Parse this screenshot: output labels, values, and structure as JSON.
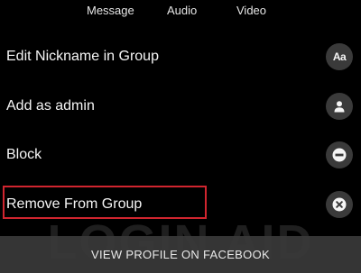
{
  "top_actions": {
    "message_label": "Message",
    "audio_label": "Audio",
    "video_label": "Video"
  },
  "menu": {
    "items": [
      {
        "label": "Edit Nickname in Group",
        "icon": "text-format-icon",
        "icon_text": "Aa"
      },
      {
        "label": "Add as admin",
        "icon": "person-icon"
      },
      {
        "label": "Block",
        "icon": "block-icon"
      },
      {
        "label": "Remove From Group",
        "icon": "remove-icon",
        "highlighted": true
      }
    ]
  },
  "bottom_bar": {
    "label": "VIEW PROFILE ON FACEBOOK"
  },
  "watermark": "LOGIN AID",
  "colors": {
    "background": "#000000",
    "icon_circle": "#3a3a3a",
    "highlight_border": "#d0252f",
    "bottom_bar": "#3a3a3a"
  }
}
